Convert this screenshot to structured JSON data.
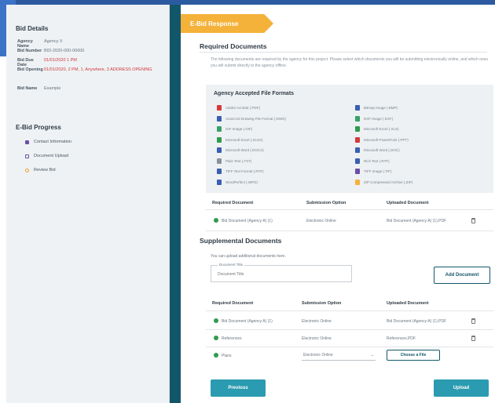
{
  "sidebar": {
    "bid_details_title": "Bid Details",
    "rows": [
      {
        "key": "Agency Name",
        "value": "Agency X",
        "red": false
      },
      {
        "key": "Bid Number",
        "value": "BID-2020-000-00000",
        "red": false
      },
      {
        "key": "Bid Due Date",
        "value": "01/01/2020 1 PM",
        "red": true
      },
      {
        "key": "Bid Opening",
        "value": "01/01/2020, 2 PM, 1, Anywhere, 3 ADDRESS OPENING",
        "red": true
      },
      {
        "key": "Bid Name",
        "value": "Example",
        "red": false
      }
    ],
    "progress_title": "E-Bid Progress",
    "progress": [
      {
        "label": "Contact Information",
        "state": "filled"
      },
      {
        "label": "Document Upload",
        "state": "outline"
      },
      {
        "label": "Review Bid",
        "state": "empty"
      }
    ]
  },
  "main": {
    "banner": "E-Bid Response",
    "required_title": "Required Documents",
    "description": "The following documents are required by the agency for this project. Please select which documents you will be submitting electronically online, and which ones you will submit directly to the agency offline.",
    "formats_title": "Agency Accepted File Formats",
    "formats_left": [
      {
        "label": "Adobe Acrobat (.PDF)",
        "color": "#d33a3a"
      },
      {
        "label": "AutoCAD Drawing File Format (.DWG)",
        "color": "#3a5fb0"
      },
      {
        "label": "GIF Image (.GIF)",
        "color": "#3aa06a"
      },
      {
        "label": "Microsoft Excel (.XLSX)",
        "color": "#2e9c4d"
      },
      {
        "label": "Microsoft Word (.DOCX)",
        "color": "#3a5fb0"
      },
      {
        "label": "Plain Text (.TXT)",
        "color": "#8a939b"
      },
      {
        "label": "TIFF Text Format (.RTF)",
        "color": "#3a5fb0"
      },
      {
        "label": "WordPerfect (.WPD)",
        "color": "#3a5fb0"
      }
    ],
    "formats_right": [
      {
        "label": "Bitmap Image (.BMP)",
        "color": "#3a5fb0"
      },
      {
        "label": "DXF Image (.DXF)",
        "color": "#3aa06a"
      },
      {
        "label": "Microsoft Excel (.XLS)",
        "color": "#2e9c4d"
      },
      {
        "label": "Microsoft PowerPoint (.PPT)",
        "color": "#d33a3a"
      },
      {
        "label": "Microsoft Word (.DOC)",
        "color": "#3a5fb0"
      },
      {
        "label": "Rich Text (.RTF)",
        "color": "#3a5fb0"
      },
      {
        "label": "TIFF Image (.TIF)",
        "color": "#6b4fa6"
      },
      {
        "label": "ZIP Compressed Archive (.ZIP)",
        "color": "#f4b23a"
      }
    ],
    "req_table": {
      "headers": [
        "Required Document",
        "Submission Option",
        "Uploaded Document"
      ],
      "row": [
        "Bid Document (Agency A) (1)",
        "Electronic Online",
        "Bid Document (Agency A) (1).PDF"
      ]
    },
    "supp_title": "Supplemental Documents",
    "supp_desc": "You can upload additional documents here.",
    "doc_title_label": "Document Title",
    "doc_title_placeholder": "Document Title",
    "add_document": "Add Document",
    "supp_table": {
      "headers": [
        "Required Document",
        "Submission Option",
        "Uploaded Document"
      ],
      "rows": [
        {
          "doc": "Bid Document (Agency A) (1)",
          "option": "Electronic Online",
          "uploaded": "Bid Document (Agency A) (1).PDF",
          "trash": true
        },
        {
          "doc": "References",
          "option": "Electronic Online",
          "uploaded": "References.PDF",
          "trash": true
        },
        {
          "doc": "Plans",
          "option": "Electronic Online",
          "uploaded": "",
          "trash": false
        }
      ],
      "choose_file": "Choose a File"
    },
    "previous": "Previous",
    "upload": "Upload"
  }
}
